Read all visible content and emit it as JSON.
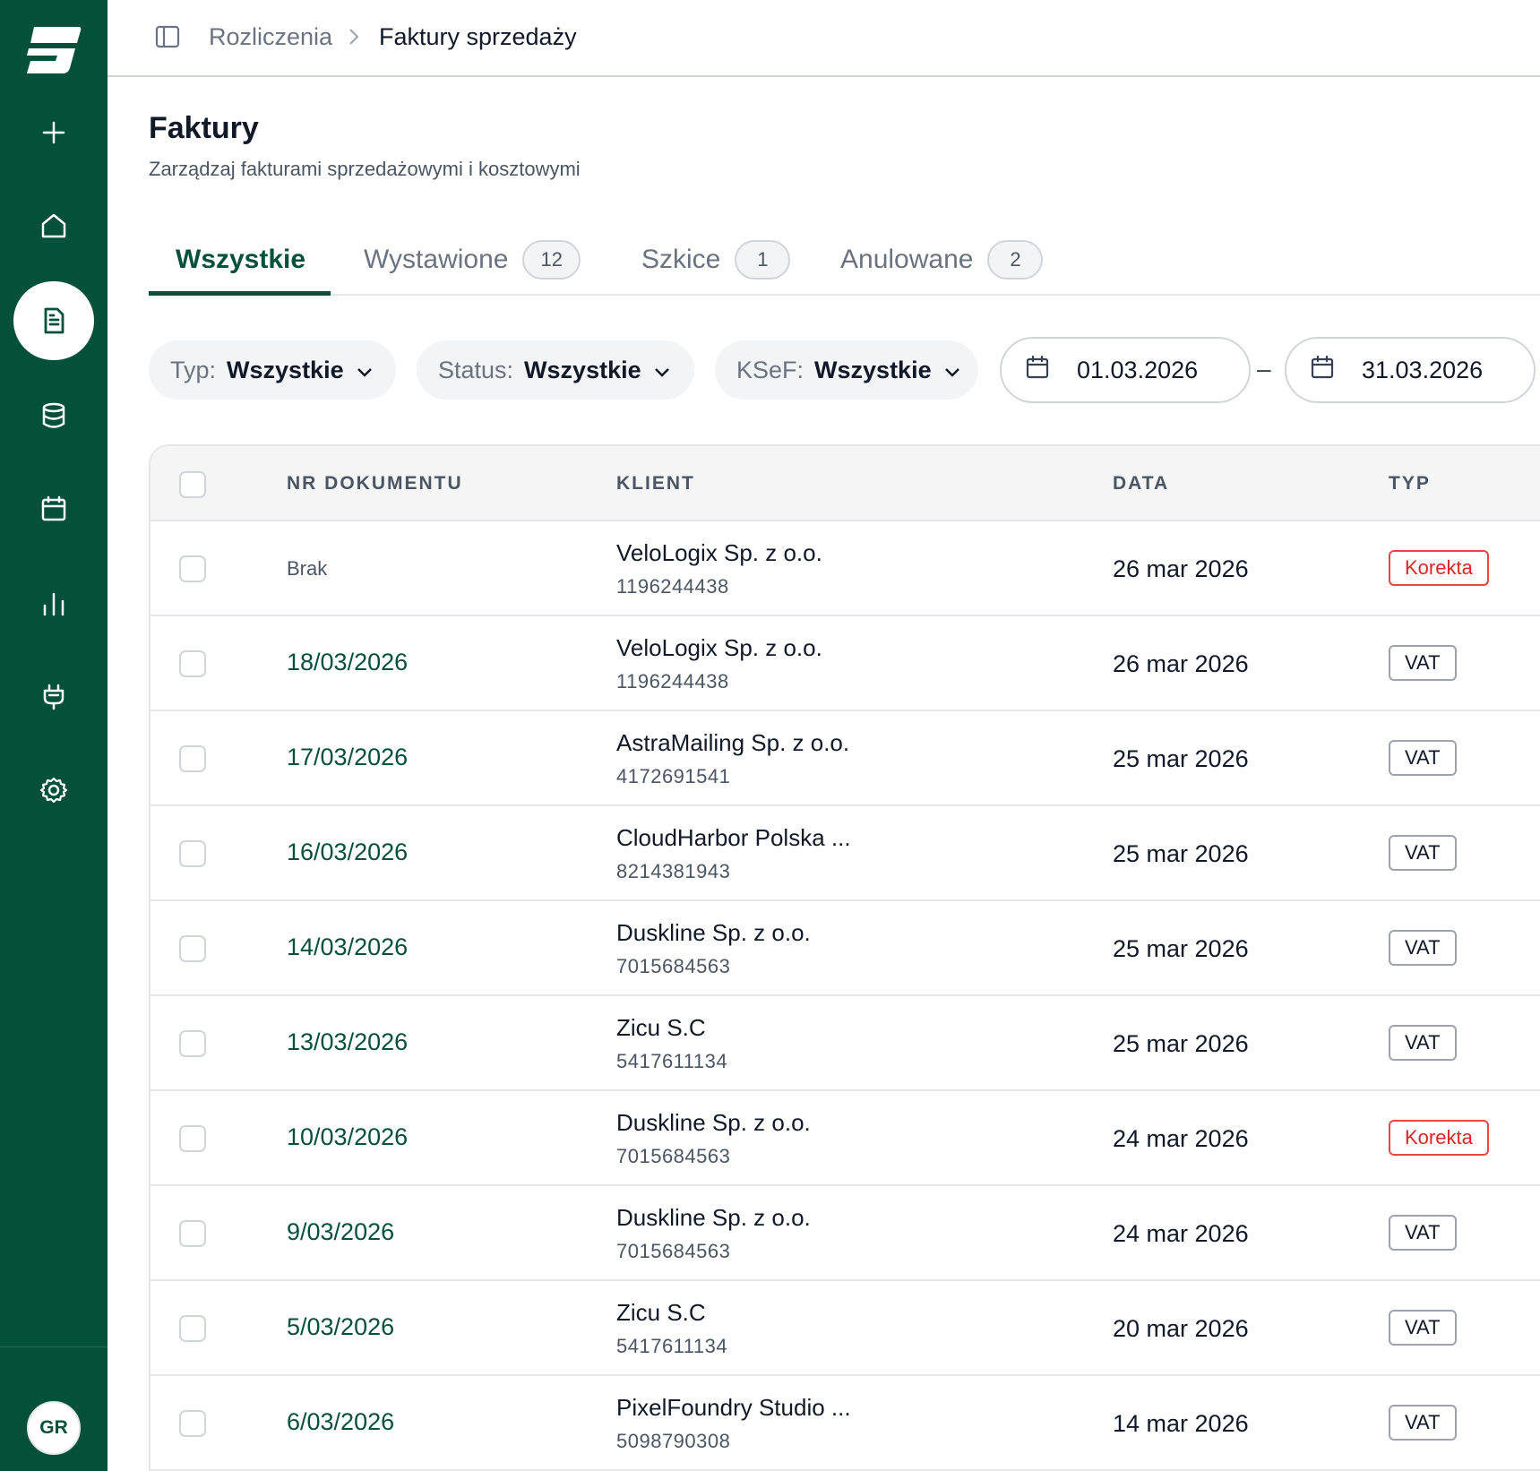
{
  "app": {
    "logo": "app-logo",
    "avatar_initials": "GR",
    "sidebar": [
      {
        "name": "add-icon",
        "active": false
      },
      {
        "name": "home-icon",
        "active": false
      },
      {
        "name": "document-icon",
        "active": true
      },
      {
        "name": "database-icon",
        "active": false
      },
      {
        "name": "calendar-icon",
        "active": false
      },
      {
        "name": "chart-icon",
        "active": false
      },
      {
        "name": "plug-icon",
        "active": false
      },
      {
        "name": "settings-icon",
        "active": false
      }
    ]
  },
  "breadcrumb": {
    "parent": "Rozliczenia",
    "current": "Faktury sprzedaży"
  },
  "header": {
    "title": "Faktury",
    "subtitle": "Zarządzaj fakturami sprzedażowymi i kosztowymi"
  },
  "tabs": [
    {
      "label": "Wszystkie",
      "count": null,
      "active": true
    },
    {
      "label": "Wystawione",
      "count": "12",
      "active": false
    },
    {
      "label": "Szkice",
      "count": "1",
      "active": false
    },
    {
      "label": "Anulowane",
      "count": "2",
      "active": false
    }
  ],
  "filters": {
    "type": {
      "label": "Typ:",
      "value": "Wszystkie"
    },
    "status": {
      "label": "Status:",
      "value": "Wszystkie"
    },
    "ksef": {
      "label": "KSeF:",
      "value": "Wszystkie"
    },
    "date_from": "01.03.2026",
    "date_separator": "–",
    "date_to": "31.03.2026"
  },
  "table": {
    "columns": [
      "NR DOKUMENTU",
      "KLIENT",
      "DATA",
      "TYP"
    ],
    "rows": [
      {
        "doc": "Brak",
        "client": "VeloLogix Sp. z o.o.",
        "nip": "1196244438",
        "date": "26 mar 2026",
        "type": "Korekta"
      },
      {
        "doc": "18/03/2026",
        "client": "VeloLogix Sp. z o.o.",
        "nip": "1196244438",
        "date": "26 mar 2026",
        "type": "VAT"
      },
      {
        "doc": "17/03/2026",
        "client": "AstraMailing Sp. z o.o.",
        "nip": "4172691541",
        "date": "25 mar 2026",
        "type": "VAT"
      },
      {
        "doc": "16/03/2026",
        "client": "CloudHarbor Polska ...",
        "nip": "8214381943",
        "date": "25 mar 2026",
        "type": "VAT"
      },
      {
        "doc": "14/03/2026",
        "client": "Duskline Sp. z o.o.",
        "nip": "7015684563",
        "date": "25 mar 2026",
        "type": "VAT"
      },
      {
        "doc": "13/03/2026",
        "client": "Zicu S.C",
        "nip": "5417611134",
        "date": "25 mar 2026",
        "type": "VAT"
      },
      {
        "doc": "10/03/2026",
        "client": "Duskline Sp. z o.o.",
        "nip": "7015684563",
        "date": "24 mar 2026",
        "type": "Korekta"
      },
      {
        "doc": "9/03/2026",
        "client": "Duskline Sp. z o.o.",
        "nip": "7015684563",
        "date": "24 mar 2026",
        "type": "VAT"
      },
      {
        "doc": "5/03/2026",
        "client": "Zicu S.C",
        "nip": "5417611134",
        "date": "20 mar 2026",
        "type": "VAT"
      },
      {
        "doc": "6/03/2026",
        "client": "PixelFoundry Studio ...",
        "nip": "5098790308",
        "date": "14 mar 2026",
        "type": "VAT"
      }
    ]
  },
  "colors": {
    "brand": "#05503a",
    "correction": "#dc2626"
  }
}
